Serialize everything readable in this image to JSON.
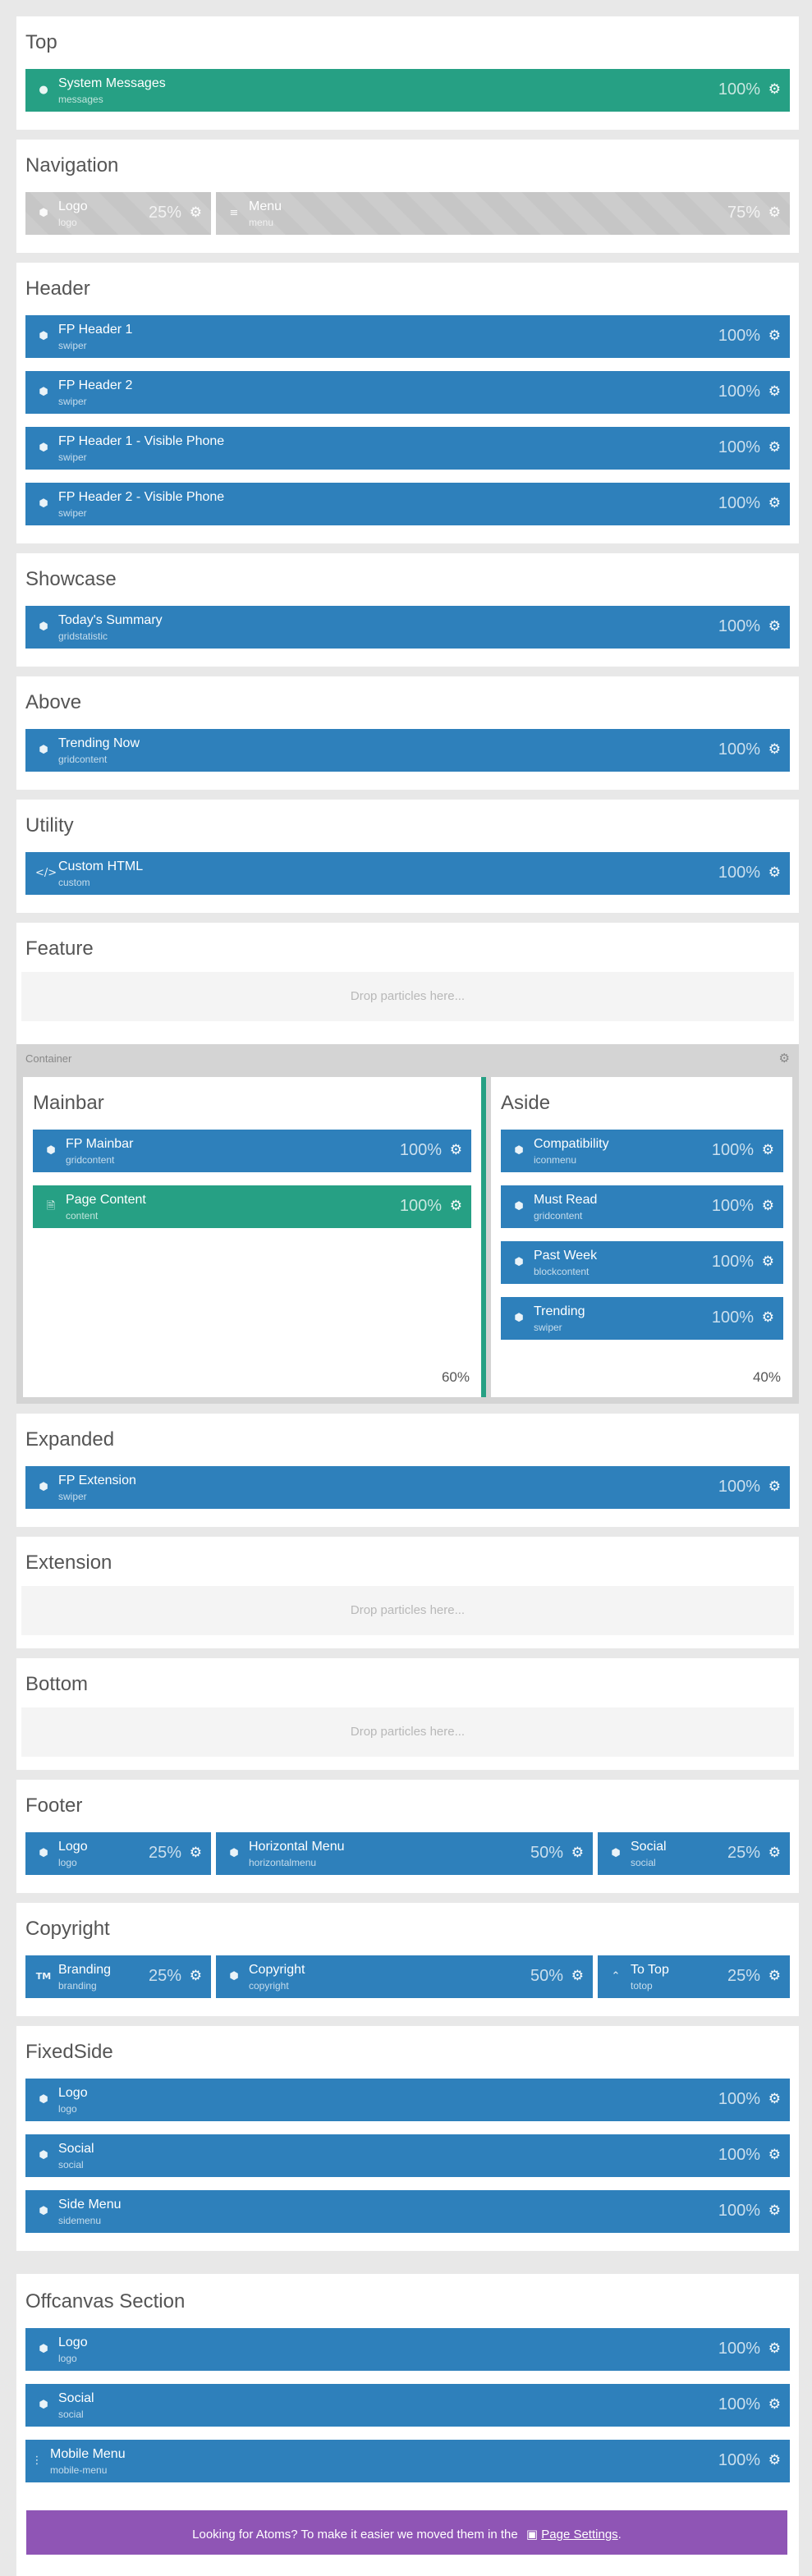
{
  "top": {
    "title": "Top",
    "particles": [
      {
        "title": "System Messages",
        "subtitle": "messages",
        "percent": "100%",
        "icon": "info-icon"
      }
    ]
  },
  "navigation": {
    "title": "Navigation",
    "particles": [
      {
        "title": "Logo",
        "subtitle": "logo",
        "percent": "25%",
        "icon": "cube-icon"
      },
      {
        "title": "Menu",
        "subtitle": "menu",
        "percent": "75%",
        "icon": "menu-icon"
      }
    ]
  },
  "header": {
    "title": "Header",
    "particles": [
      {
        "title": "FP Header 1",
        "subtitle": "swiper",
        "percent": "100%",
        "icon": "cube-icon"
      },
      {
        "title": "FP Header 2",
        "subtitle": "swiper",
        "percent": "100%",
        "icon": "cube-icon"
      },
      {
        "title": "FP Header 1 - Visible Phone",
        "subtitle": "swiper",
        "percent": "100%",
        "icon": "cube-icon"
      },
      {
        "title": "FP Header 2 - Visible Phone",
        "subtitle": "swiper",
        "percent": "100%",
        "icon": "cube-icon"
      }
    ]
  },
  "showcase": {
    "title": "Showcase",
    "particles": [
      {
        "title": "Today's Summary",
        "subtitle": "gridstatistic",
        "percent": "100%",
        "icon": "cube-icon"
      }
    ]
  },
  "above": {
    "title": "Above",
    "particles": [
      {
        "title": "Trending Now",
        "subtitle": "gridcontent",
        "percent": "100%",
        "icon": "cube-icon"
      }
    ]
  },
  "utility": {
    "title": "Utility",
    "particles": [
      {
        "title": "Custom HTML",
        "subtitle": "custom",
        "percent": "100%",
        "icon": "code-icon"
      }
    ]
  },
  "feature": {
    "title": "Feature",
    "drop_text": "Drop particles here..."
  },
  "container": {
    "label": "Container",
    "mainbar": {
      "title": "Mainbar",
      "percent": "60%",
      "particles": [
        {
          "title": "FP Mainbar",
          "subtitle": "gridcontent",
          "percent": "100%",
          "icon": "cube-icon"
        },
        {
          "title": "Page Content",
          "subtitle": "content",
          "percent": "100%",
          "icon": "file-icon"
        }
      ]
    },
    "aside": {
      "title": "Aside",
      "percent": "40%",
      "particles": [
        {
          "title": "Compatibility",
          "subtitle": "iconmenu",
          "percent": "100%",
          "icon": "cube-icon"
        },
        {
          "title": "Must Read",
          "subtitle": "gridcontent",
          "percent": "100%",
          "icon": "cube-icon"
        },
        {
          "title": "Past Week",
          "subtitle": "blockcontent",
          "percent": "100%",
          "icon": "cube-icon"
        },
        {
          "title": "Trending",
          "subtitle": "swiper",
          "percent": "100%",
          "icon": "cube-icon"
        }
      ]
    }
  },
  "expanded": {
    "title": "Expanded",
    "particles": [
      {
        "title": "FP Extension",
        "subtitle": "swiper",
        "percent": "100%",
        "icon": "cube-icon"
      }
    ]
  },
  "extension": {
    "title": "Extension",
    "drop_text": "Drop particles here..."
  },
  "bottom": {
    "title": "Bottom",
    "drop_text": "Drop particles here..."
  },
  "footer": {
    "title": "Footer",
    "particles": [
      {
        "title": "Logo",
        "subtitle": "logo",
        "percent": "25%",
        "icon": "cube-icon"
      },
      {
        "title": "Horizontal Menu",
        "subtitle": "horizontalmenu",
        "percent": "50%",
        "icon": "cube-icon"
      },
      {
        "title": "Social",
        "subtitle": "social",
        "percent": "25%",
        "icon": "cube-icon"
      }
    ]
  },
  "copyright": {
    "title": "Copyright",
    "particles": [
      {
        "title": "Branding",
        "subtitle": "branding",
        "percent": "25%",
        "icon": "trademark-icon"
      },
      {
        "title": "Copyright",
        "subtitle": "copyright",
        "percent": "50%",
        "icon": "cube-icon"
      },
      {
        "title": "To Top",
        "subtitle": "totop",
        "percent": "25%",
        "icon": "chevron-up-icon"
      }
    ]
  },
  "fixedside": {
    "title": "FixedSide",
    "particles": [
      {
        "title": "Logo",
        "subtitle": "logo",
        "percent": "100%",
        "icon": "cube-icon"
      },
      {
        "title": "Social",
        "subtitle": "social",
        "percent": "100%",
        "icon": "cube-icon"
      },
      {
        "title": "Side Menu",
        "subtitle": "sidemenu",
        "percent": "100%",
        "icon": "cube-icon"
      }
    ]
  },
  "offcanvas": {
    "title": "Offcanvas Section",
    "particles": [
      {
        "title": "Logo",
        "subtitle": "logo",
        "percent": "100%",
        "icon": "cube-icon"
      },
      {
        "title": "Social",
        "subtitle": "social",
        "percent": "100%",
        "icon": "cube-icon"
      },
      {
        "title": "Mobile Menu",
        "subtitle": "mobile-menu",
        "percent": "100%",
        "icon": "ellipsis-vertical-icon"
      }
    ]
  },
  "promo": {
    "text": "Looking for Atoms? To make it easier we moved them in the",
    "link_icon": "settings-window-icon",
    "link_text": "Page Settings",
    "end": "."
  },
  "colors": {
    "blue": "#2e80bb",
    "green": "#26a084",
    "purple": "#8f55b5",
    "disabled": "#c6c6c6"
  }
}
